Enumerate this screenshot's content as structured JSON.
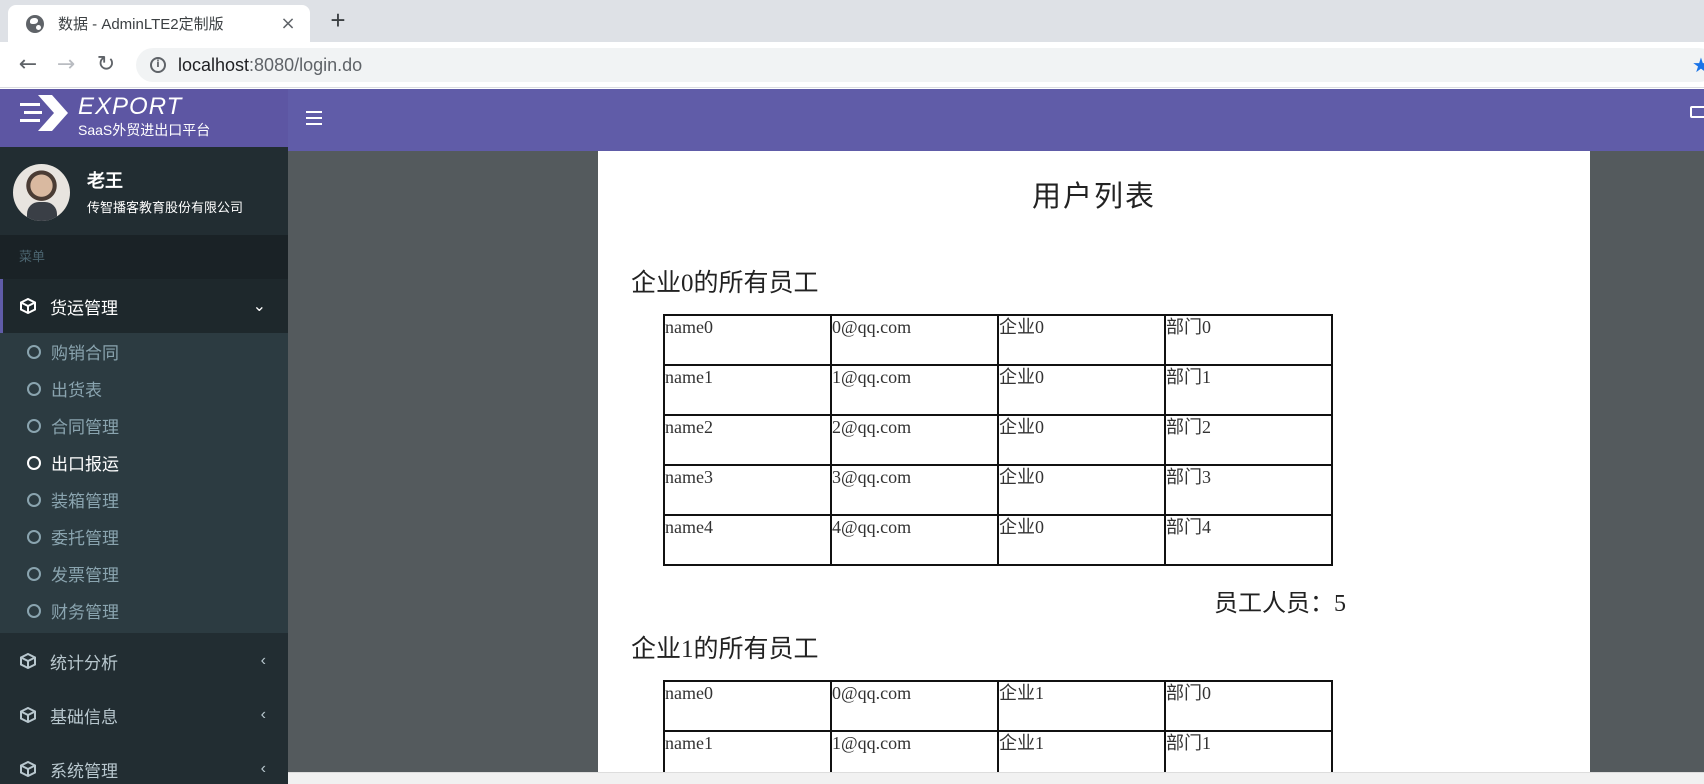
{
  "browser": {
    "tab_title": "数据 - AdminLTE2定制版",
    "tab_close": "×",
    "new_tab": "+",
    "url_host": "localhost",
    "url_rest": ":8080/login.do"
  },
  "brand": {
    "logo_text": "EXPORT",
    "subtitle": "SaaS外贸进出口平台"
  },
  "user": {
    "name": "老王",
    "org": "传智播客教育股份有限公司"
  },
  "sidebar": {
    "header": "菜单",
    "active_menu": {
      "label": "货运管理",
      "arrow": "⌄"
    },
    "submenu": [
      {
        "label": "购销合同"
      },
      {
        "label": "出货表"
      },
      {
        "label": "合同管理"
      },
      {
        "label": "出口报运"
      },
      {
        "label": "装箱管理"
      },
      {
        "label": "委托管理"
      },
      {
        "label": "发票管理"
      },
      {
        "label": "财务管理"
      }
    ],
    "menus": [
      {
        "label": "统计分析",
        "arrow": "‹"
      },
      {
        "label": "基础信息",
        "arrow": "‹"
      },
      {
        "label": "系统管理",
        "arrow": "‹"
      }
    ]
  },
  "doc": {
    "title": "用户列表",
    "sections": [
      {
        "title": "企业0的所有员工",
        "rows": [
          [
            "name0",
            "0@qq.com",
            "企业0",
            "部门0"
          ],
          [
            "name1",
            "1@qq.com",
            "企业0",
            "部门1"
          ],
          [
            "name2",
            "2@qq.com",
            "企业0",
            "部门2"
          ],
          [
            "name3",
            "3@qq.com",
            "企业0",
            "部门3"
          ],
          [
            "name4",
            "4@qq.com",
            "企业0",
            "部门4"
          ]
        ],
        "count_label": "员工人员：5"
      },
      {
        "title": "企业1的所有员工",
        "rows": [
          [
            "name0",
            "0@qq.com",
            "企业1",
            "部门0"
          ],
          [
            "name1",
            "1@qq.com",
            "企业1",
            "部门1"
          ]
        ]
      }
    ]
  },
  "colors": {
    "brand_purple": "#605ca8",
    "sidebar_bg": "#222d32",
    "submenu_bg": "#2c3b41",
    "content_bg": "#545a5d"
  }
}
